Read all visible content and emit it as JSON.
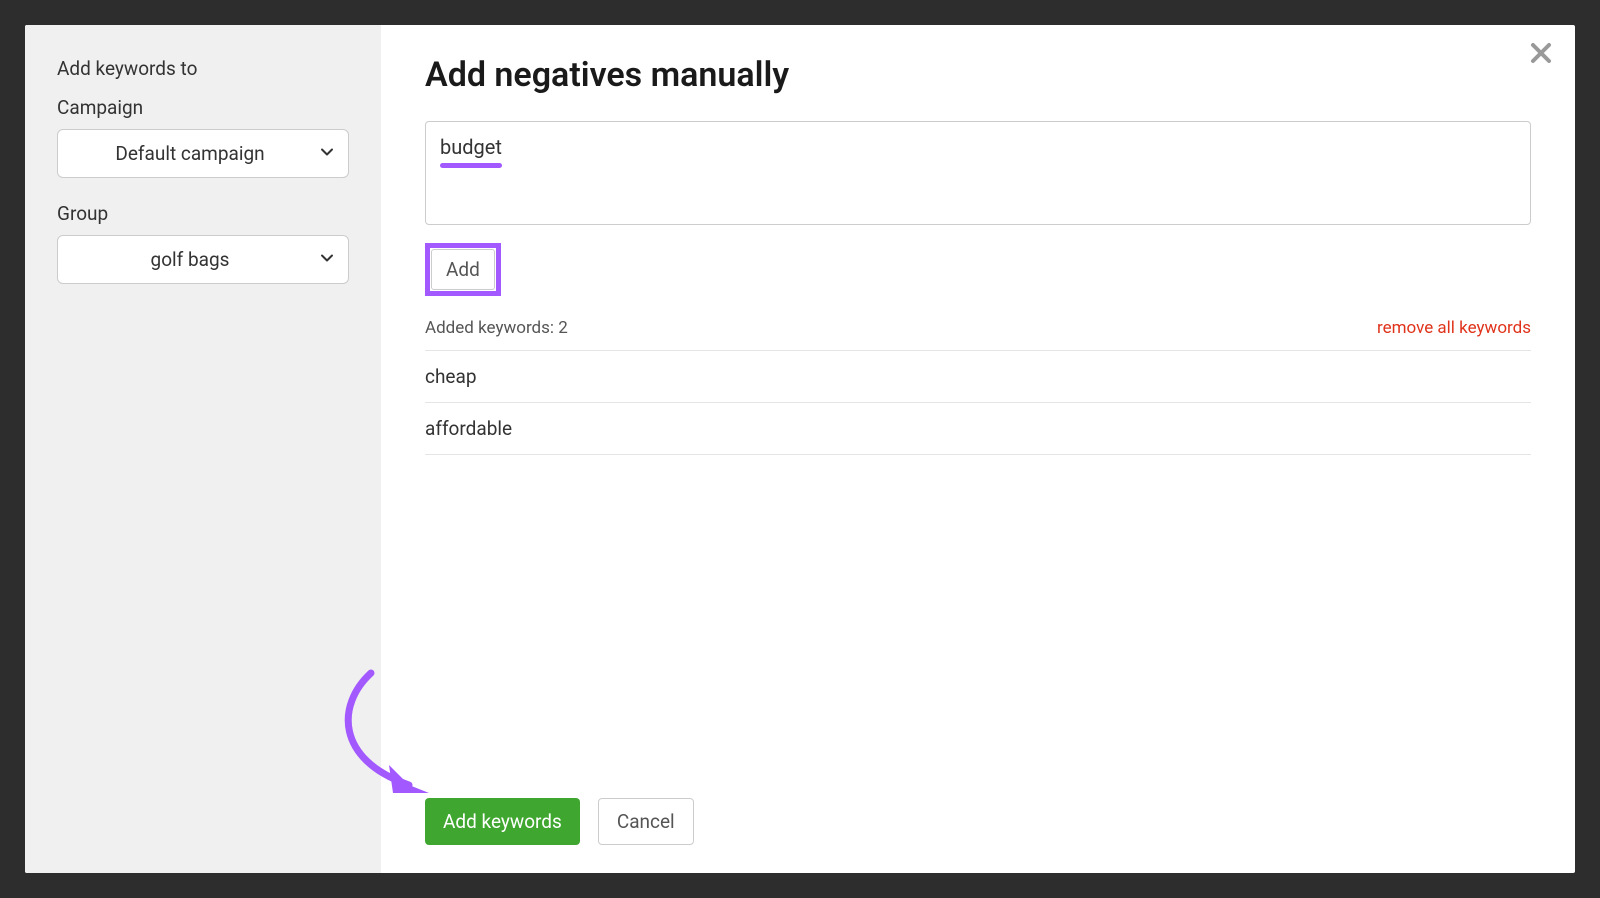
{
  "sidebar": {
    "title": "Add keywords to",
    "campaign_label": "Campaign",
    "campaign_value": "Default campaign",
    "group_label": "Group",
    "group_value": "golf bags"
  },
  "main": {
    "title": "Add negatives manually",
    "textarea_value": "budget",
    "add_button_label": "Add",
    "added_keywords_label": "Added keywords: 2",
    "remove_all_label": "remove all keywords",
    "keywords": [
      "cheap",
      "affordable"
    ]
  },
  "footer": {
    "primary_label": "Add keywords",
    "cancel_label": "Cancel"
  }
}
